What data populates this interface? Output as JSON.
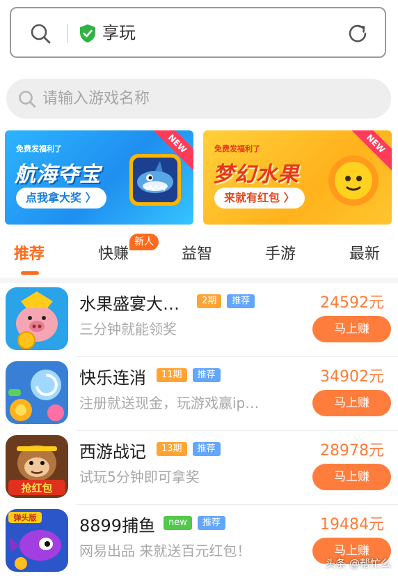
{
  "browser": {
    "title": "享玩"
  },
  "search": {
    "placeholder": "请输入游戏名称"
  },
  "banners": [
    {
      "subtitle": "免费发福利了",
      "title": "航海夺宝",
      "button": "点我拿大奖 〉",
      "badge": "NEW"
    },
    {
      "subtitle": "免费发福利了",
      "title": "梦幻水果",
      "button": "来就有红包 〉",
      "badge": "NEW"
    }
  ],
  "tabs": [
    {
      "label": "推荐",
      "active": true
    },
    {
      "label": "快赚",
      "badge": "新人"
    },
    {
      "label": "益智"
    },
    {
      "label": "手游"
    },
    {
      "label": "最新"
    }
  ],
  "games": [
    {
      "name": "水果盛宴大…",
      "period": "2期",
      "rec": "推荐",
      "desc": "三分钟就能领奖",
      "reward": "24592元",
      "button": "马上赚"
    },
    {
      "name": "快乐连消",
      "period": "11期",
      "rec": "推荐",
      "desc": "注册就送现金，玩游戏赢ip…",
      "reward": "34902元",
      "button": "马上赚"
    },
    {
      "name": "西游战记",
      "period": "13期",
      "rec": "推荐",
      "desc": "试玩5分钟即可拿奖",
      "reward": "28978元",
      "button": "马上赚"
    },
    {
      "name": "8899捕鱼",
      "period": "new",
      "rec": "推荐",
      "desc": "网易出品 来就送百元红包！",
      "reward": "19484元",
      "button": "马上赚"
    }
  ],
  "game_icon_art": [
    "red-envelope-text",
    "",
    "red-envelope-text",
    "bullet-head-text"
  ],
  "icon_art_labels": {
    "g3": "抢红包",
    "g4": "弹头版"
  },
  "watermark": "头条 @帮忙么",
  "colors": {
    "accent": "#ff6a1d",
    "button": "#ff7d3c",
    "reward": "#ff7a36",
    "tag_period": "#ffa431",
    "tag_rec": "#63a6ff",
    "tag_new": "#51c94b"
  }
}
